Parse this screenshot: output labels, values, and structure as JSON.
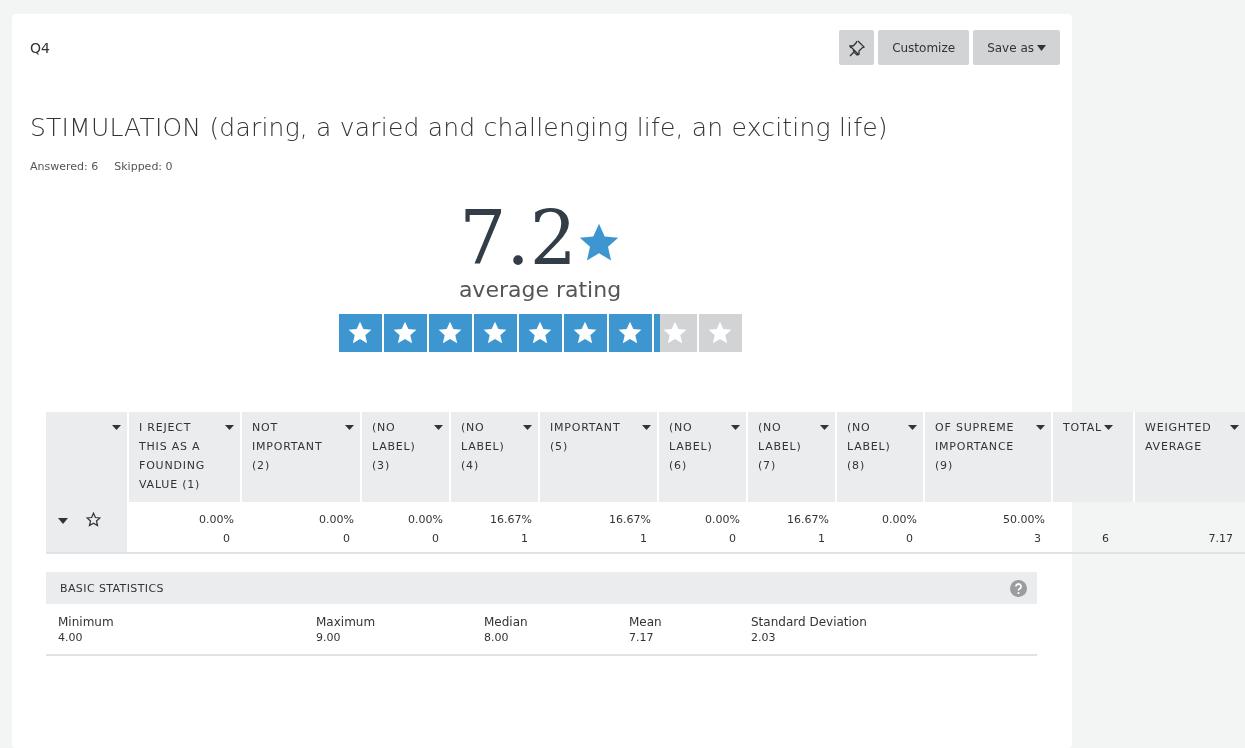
{
  "question": {
    "number": "Q4",
    "title": "STIMULATION (daring, a varied and challenging life, an exciting life)",
    "answered": "Answered: 6",
    "skipped": "Skipped: 0"
  },
  "toolbar": {
    "buttons": [
      {
        "kind": "pin"
      },
      {
        "kind": "text",
        "label": "Customize"
      },
      {
        "kind": "menu",
        "label": "Save as"
      }
    ]
  },
  "rating": {
    "value": "7.2",
    "caption": "average rating",
    "level": 0.797
  },
  "table": {
    "columns": [
      {
        "label": "I REJECT THIS AS A FOUNDING VALUE (1)"
      },
      {
        "label": "NOT IMPORTANT (2)"
      },
      {
        "label": "(NO LABEL) (3)"
      },
      {
        "label": "(NO LABEL) (4)"
      },
      {
        "label": "IMPORTANT (5)"
      },
      {
        "label": "(NO LABEL) (6)"
      },
      {
        "label": "(NO LABEL) (7)"
      },
      {
        "label": "(NO LABEL) (8)"
      },
      {
        "label": "OF SUPREME IMPORTANCE (9)"
      },
      {
        "label": "TOTAL"
      },
      {
        "label": "WEIGHTED AVERAGE"
      }
    ],
    "rows": [
      {
        "cells": [
          {
            "percent": "0.00%",
            "count": "0"
          },
          {
            "percent": "0.00%",
            "count": "0"
          },
          {
            "percent": "0.00%",
            "count": "0"
          },
          {
            "percent": "16.67%",
            "count": "1"
          },
          {
            "percent": "16.67%",
            "count": "1"
          },
          {
            "percent": "0.00%",
            "count": "0"
          },
          {
            "percent": "16.67%",
            "count": "1"
          },
          {
            "percent": "0.00%",
            "count": "0"
          },
          {
            "percent": "50.00%",
            "count": "3"
          }
        ],
        "total": "6",
        "weighted_average": "7.17"
      }
    ]
  },
  "statistics": {
    "title": "BASIC STATISTICS",
    "items": [
      {
        "label": "Minimum",
        "value": "4.00"
      },
      {
        "label": "Maximum",
        "value": "9.00"
      },
      {
        "label": "Median",
        "value": "8.00"
      },
      {
        "label": "Mean",
        "value": "7.17"
      },
      {
        "label": "Standard Deviation",
        "value": "2.03"
      }
    ]
  }
}
